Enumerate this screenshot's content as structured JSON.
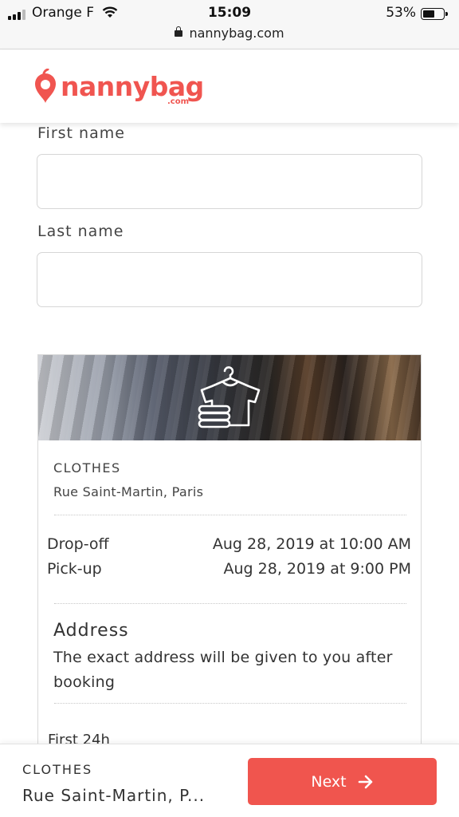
{
  "status": {
    "carrier": "Orange F",
    "time": "15:09",
    "battery": "53%",
    "battery_level": 0.53,
    "url": "nannybag.com"
  },
  "header": {
    "logo_text": "nannybag",
    "logo_suffix": ".com",
    "brand_color": "#f05550"
  },
  "form": {
    "first_name_label": "First name",
    "first_name_value": "",
    "last_name_label": "Last name",
    "last_name_value": ""
  },
  "card": {
    "banner_icon": "clothes-hanger-icon",
    "category": "CLOTHES",
    "location": "Rue Saint-Martin, Paris",
    "dropoff_label": "Drop-off",
    "dropoff_value": "Aug 28, 2019 at 10:00 AM",
    "pickup_label": "Pick-up",
    "pickup_value": "Aug 28, 2019 at 9:00 PM",
    "address_title": "Address",
    "address_text": "The exact address will be given to you after booking",
    "first_24h_label": "First 24h"
  },
  "bottom": {
    "category": "CLOTHES",
    "location": "Rue Saint-Martin, P...",
    "next_label": "Next",
    "next_icon": "arrow-right-icon",
    "button_color": "#f0554e"
  }
}
